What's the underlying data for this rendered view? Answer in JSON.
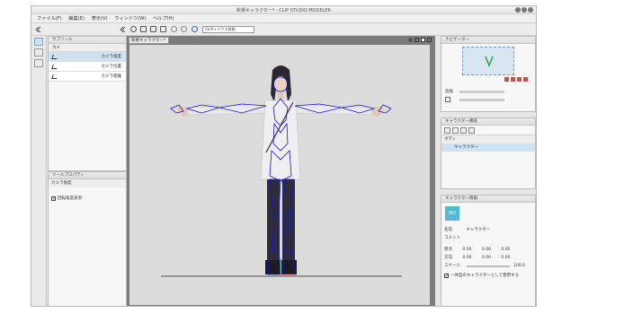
{
  "window": {
    "title": "新規キャラクター* - CLIP STUDIO MODELER"
  },
  "menu": [
    "ファイル(F)",
    "編集(E)",
    "表示(V)",
    "ウィンドウ(W)",
    "ヘルプ(H)"
  ],
  "toolbar": {
    "camera_mode": "Shift+マウス移動"
  },
  "left_panel": {
    "tab_label": "サブツール",
    "tool_label": "カメ",
    "subtools": [
      "カメラ角度",
      "カメラ位置",
      "カメラ距離"
    ],
    "selected_index": 0
  },
  "tool_property": {
    "header": "ツールプロパティ",
    "title": "カメラ角度",
    "checkbox_label": "回転角度表現",
    "checked": true
  },
  "document": {
    "tab_label": "新規キャラクター*"
  },
  "navigator": {
    "header": "ナビゲーター",
    "scale_label": "首振"
  },
  "character_structure": {
    "header": "キャラクター構成",
    "folder_label": "ボディ",
    "item_label": "キャラクター"
  },
  "character_info": {
    "header": "キャラクター情報",
    "thumb_text": "NO",
    "name_label": "名前",
    "name_value": "キャラクター",
    "comment_label": "コメント",
    "origin_label": "原点",
    "direction_label": "方向",
    "origin_values": [
      "0.00",
      "0.00",
      "0.00"
    ],
    "direction_values": [
      "0.00",
      "0.00",
      "0.00"
    ],
    "scale_label": "スケール",
    "scale_value": "100.0",
    "checkbox_label": "一体型のキャラクターとして使用する",
    "checked": true
  },
  "colors": {
    "selection": "#cfe2f2",
    "bone": "#1a17c8",
    "highlight": "#3c8fd2"
  }
}
